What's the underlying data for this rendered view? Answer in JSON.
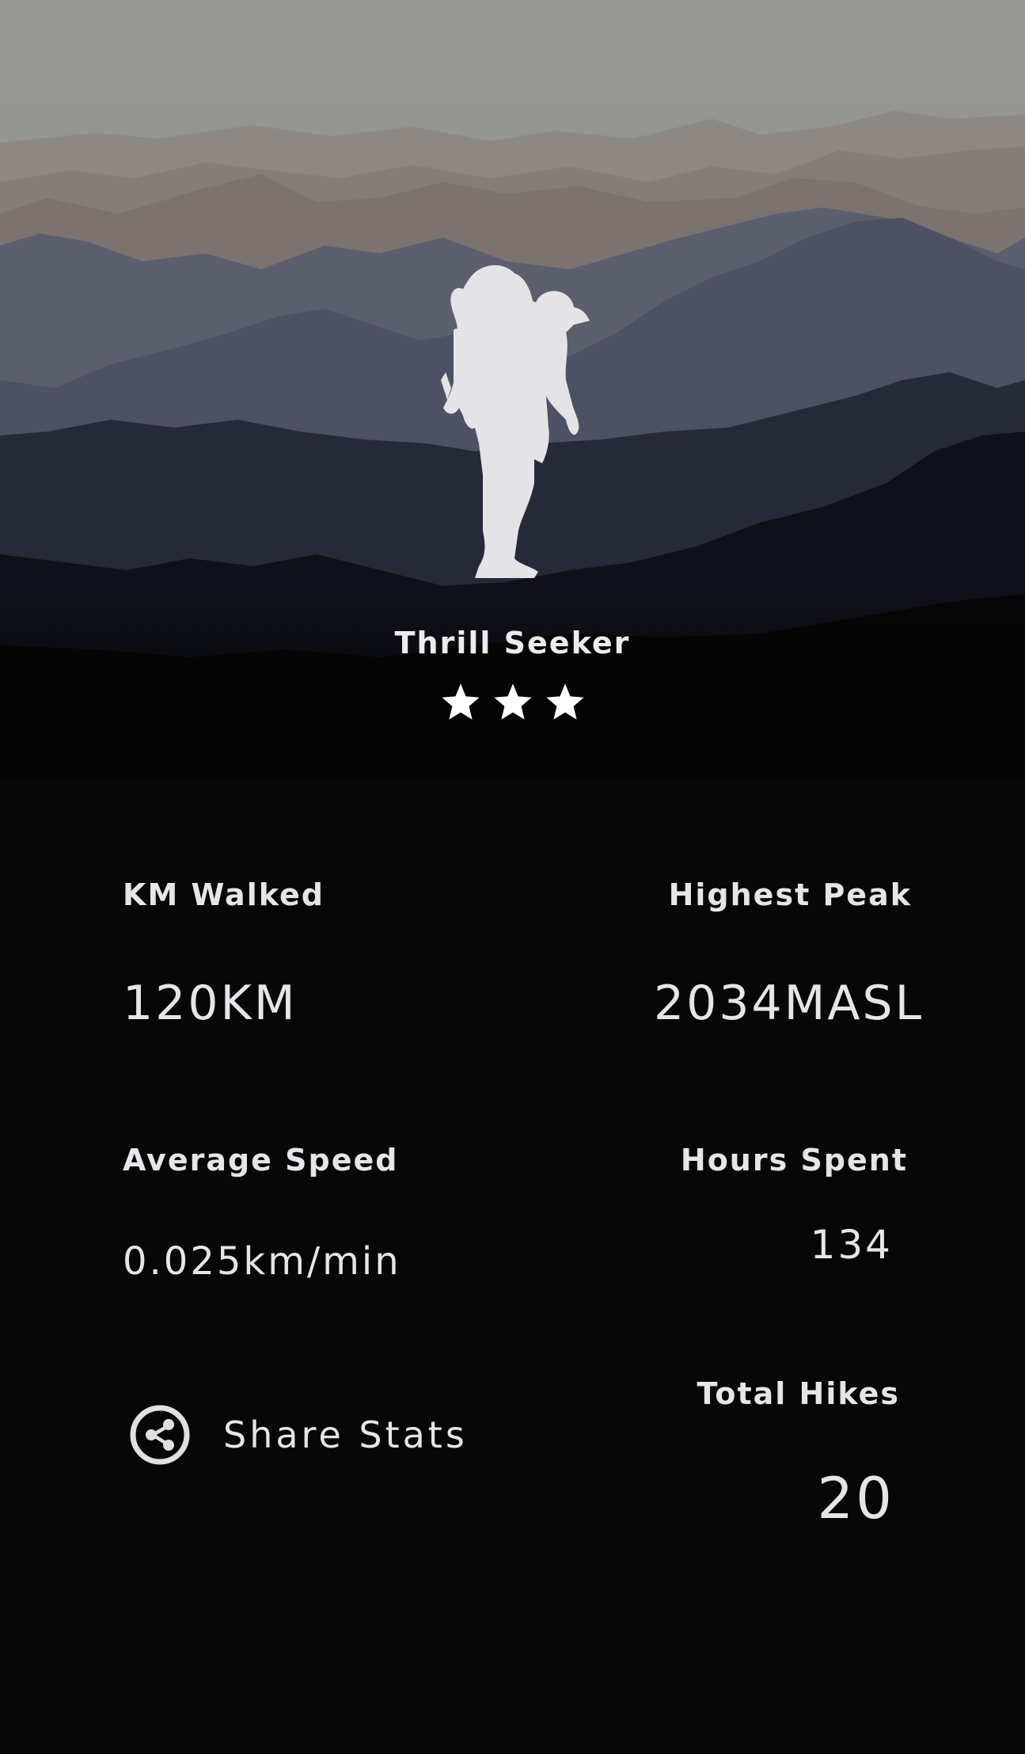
{
  "profile": {
    "title": "Thrill Seeker",
    "star_rating": 3,
    "hero_image": "hiker-silhouette-mountains"
  },
  "stats": {
    "km_walked": {
      "label": "KM Walked",
      "value": "120KM"
    },
    "highest_peak": {
      "label": "Highest Peak",
      "value": "2034MASL"
    },
    "average_speed": {
      "label": "Average Speed",
      "value": "0.025km/min"
    },
    "hours_spent": {
      "label": "Hours Spent",
      "value": "134"
    },
    "total_hikes": {
      "label": "Total Hikes",
      "value": "20"
    }
  },
  "share": {
    "label": "Share Stats",
    "icon": "share-icon"
  },
  "colors": {
    "background": "#070707",
    "text": "#e6e6ea",
    "sky": "#939390",
    "mountain_far": "#7f7571",
    "mountain_mid": "#515668",
    "mountain_near": "#1a1c28"
  }
}
